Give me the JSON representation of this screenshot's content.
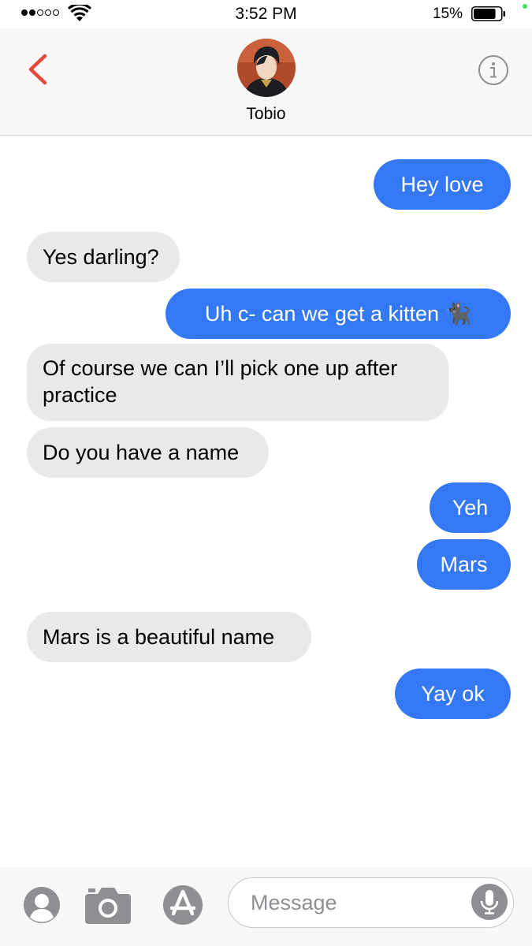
{
  "status_bar": {
    "time": "3:52 PM",
    "battery_percent": "15%",
    "battery_level": 0.15,
    "signal_bars_filled": 2,
    "signal_bars_total": 5
  },
  "header": {
    "back_icon": "chevron-left-icon",
    "contact_name": "Tobio",
    "info_icon": "info-icon",
    "accent_color": "#e5473d"
  },
  "messages": [
    {
      "direction": "sent",
      "text": "Hey love"
    },
    {
      "direction": "received",
      "text": "Yes darling?"
    },
    {
      "direction": "sent",
      "text": "Uh c- can we get a kitten 🐈‍⬛"
    },
    {
      "direction": "received",
      "text": "Of course we can I’ll pick one up after practice"
    },
    {
      "direction": "received",
      "text": "Do you have a name"
    },
    {
      "direction": "sent",
      "text": "Yeh"
    },
    {
      "direction": "sent",
      "text": "Mars"
    },
    {
      "direction": "received",
      "text": "Mars is a beautiful name"
    },
    {
      "direction": "sent",
      "text": "Yay ok"
    }
  ],
  "colors": {
    "sent_bubble": "#3478f6",
    "received_bubble": "#e9e9eb"
  },
  "input_bar": {
    "placeholder": "Message",
    "value": "",
    "icons": [
      "contact-icon",
      "camera-icon",
      "app-store-icon",
      "microphone-icon"
    ]
  }
}
